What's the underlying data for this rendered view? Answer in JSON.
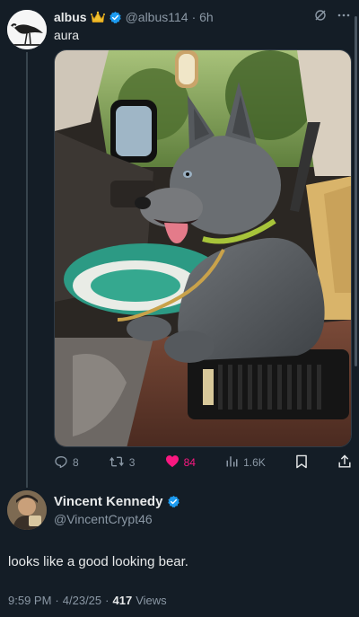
{
  "post": {
    "display_name": "albus",
    "handle": "@albus114",
    "time": "· 6h",
    "text": "aura"
  },
  "actions": {
    "replies": "8",
    "reposts": "3",
    "likes": "84",
    "views": "1.6K"
  },
  "reply": {
    "display_name": "Vincent Kennedy",
    "handle": "@VincentCrypt46",
    "text": "looks like a good looking bear.",
    "time": "9:59 PM",
    "date": "4/23/25",
    "separator": "·",
    "views_count": "417",
    "views_label": "Views"
  },
  "colors": {
    "background": "#141d26",
    "verified_blue": "#1d9bf0",
    "like_pink": "#f91880",
    "muted_text": "#8b98a5"
  },
  "icons": {
    "crown": "crown-icon",
    "verified": "verified-badge-icon",
    "grok": "grok-icon",
    "more": "more-icon",
    "reply": "reply-icon",
    "repost": "repost-icon",
    "like": "heart-icon",
    "views": "views-icon",
    "bookmark": "bookmark-icon",
    "share": "share-icon"
  }
}
